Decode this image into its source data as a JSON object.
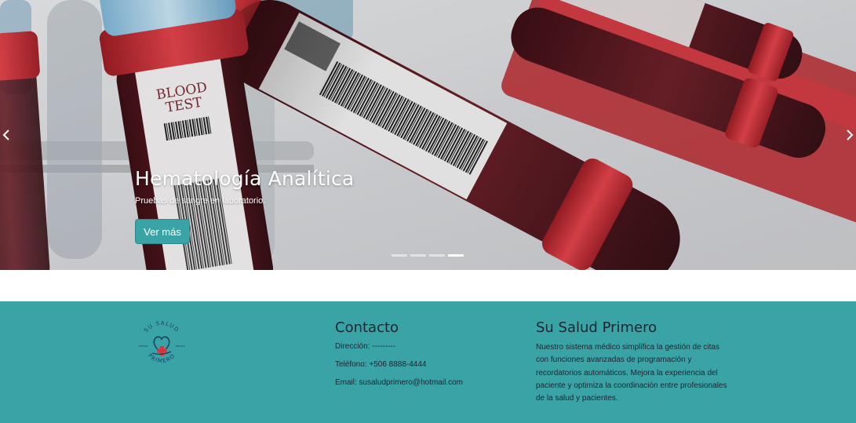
{
  "carousel": {
    "slide": {
      "image_label_line1": "BLOOD",
      "image_label_line2": "TEST",
      "title": "Hematología Analítica",
      "subtitle": "Pruebas de sangre en laboratorio.",
      "button_label": "Ver más"
    },
    "prev_icon": "chevron-left-icon",
    "next_icon": "chevron-right-icon",
    "indicator_count": 4,
    "active_indicator": 4
  },
  "footer": {
    "logo": {
      "text_top": "SU SALUD",
      "text_bottom": "PRIMERO",
      "text_left": "CENTRO",
      "text_right": "MÉDICO"
    },
    "contact": {
      "heading": "Contacto",
      "address": "Dirección: ---------",
      "phone": "Teléfono: +506 8888-4444",
      "email": "Email: susaludprimero@hotmail.com"
    },
    "about": {
      "heading": "Su Salud Primero",
      "text": "Nuestro sistema médico simplifica la gestión de citas con funciones avanzadas de programación y recordatorios automáticos. Mejora la experiencia del paciente y optimiza la coordinación entre profesionales de la salud y pacientes."
    }
  },
  "colors": {
    "teal": "#3aa3a5",
    "button": "#3aa3a5",
    "text_dark": "#1c2530",
    "tube_red": "#c62e35",
    "blood": "#5a1b22"
  }
}
